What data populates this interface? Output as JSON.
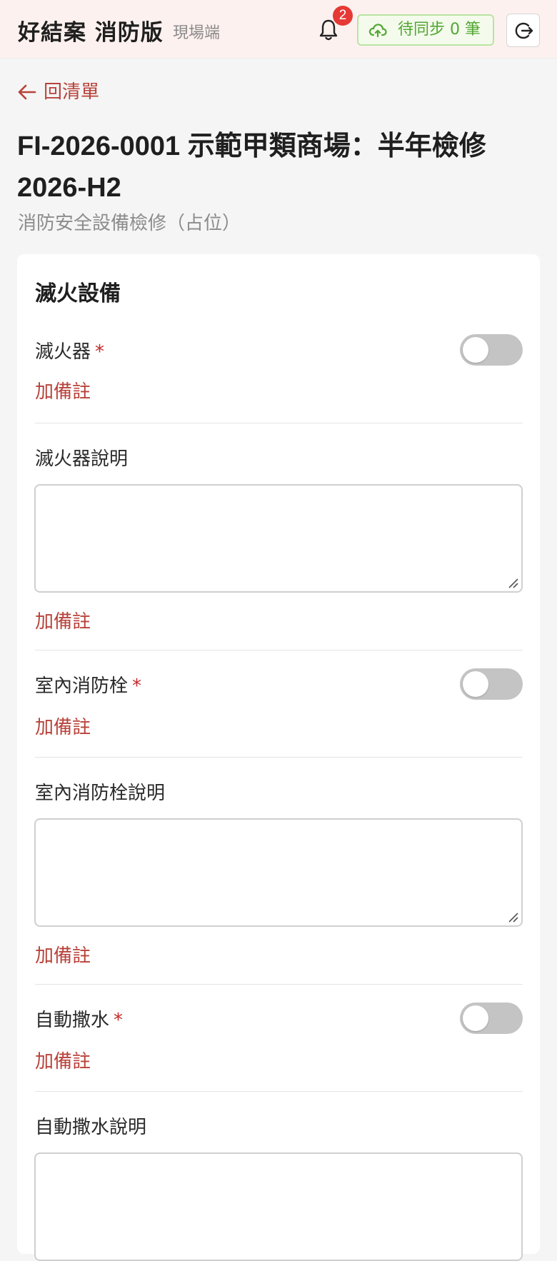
{
  "header": {
    "brand": "好結案 消防版",
    "subtitle": "現場端",
    "notification_count": "2",
    "sync_label": "待同步 0 筆"
  },
  "nav": {
    "back_label": "回清單"
  },
  "page": {
    "title": "FI-2026-0001 示範甲類商場：半年檢修 2026-H2",
    "subtitle": "消防安全設備檢修（占位）"
  },
  "section": {
    "title": "滅火設備",
    "note_label": "加備註",
    "required_mark": "*",
    "fields": [
      {
        "label": "滅火器",
        "type": "toggle",
        "required": true,
        "value": false
      },
      {
        "label": "滅火器說明",
        "type": "textarea",
        "value": ""
      },
      {
        "label": "室內消防栓",
        "type": "toggle",
        "required": true,
        "value": false
      },
      {
        "label": "室內消防栓說明",
        "type": "textarea",
        "value": ""
      },
      {
        "label": "自動撒水",
        "type": "toggle",
        "required": true,
        "value": false
      },
      {
        "label": "自動撒水說明",
        "type": "textarea",
        "value": ""
      }
    ]
  },
  "colors": {
    "accent": "#b8423a",
    "sync_green": "#52a732",
    "badge_red": "#e53935",
    "toggle_off": "#c4c4c4"
  }
}
